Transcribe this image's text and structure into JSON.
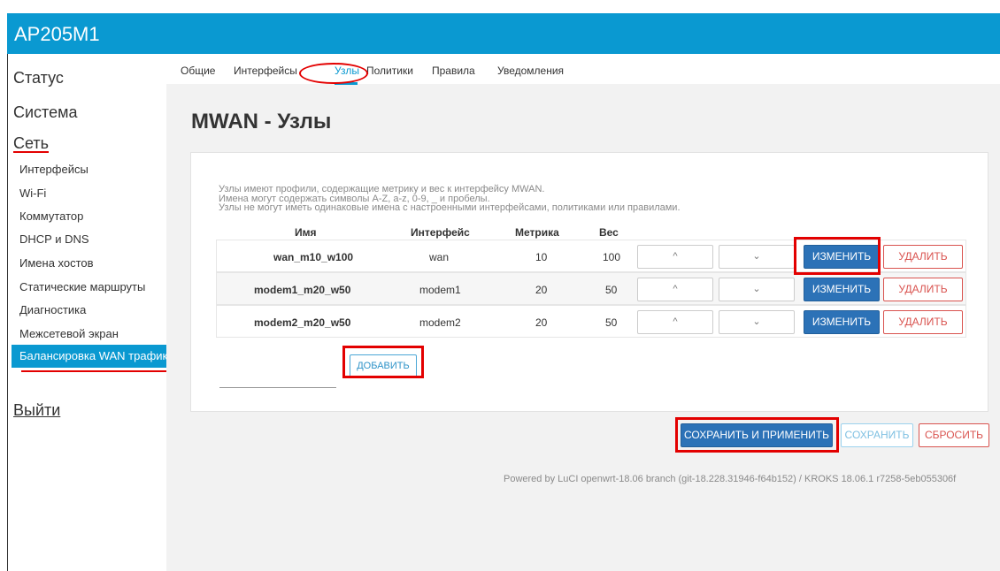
{
  "app": {
    "title": "AP205M1"
  },
  "sidebar": {
    "sections": [
      {
        "label": "Статус"
      },
      {
        "label": "Система"
      },
      {
        "label": "Сеть"
      }
    ],
    "items": [
      {
        "label": "Интерфейсы"
      },
      {
        "label": "Wi-Fi"
      },
      {
        "label": "Коммутатор"
      },
      {
        "label": "DHCP и DNS"
      },
      {
        "label": "Имена хостов"
      },
      {
        "label": "Статические маршруты"
      },
      {
        "label": "Диагностика"
      },
      {
        "label": "Межсетевой экран"
      },
      {
        "label": "Балансировка WAN трафика"
      }
    ],
    "logout": "Выйти"
  },
  "tabs": [
    {
      "label": "Общие"
    },
    {
      "label": "Интерфейсы"
    },
    {
      "label": "Узлы"
    },
    {
      "label": "Политики"
    },
    {
      "label": "Правила"
    },
    {
      "label": "Уведомления"
    }
  ],
  "page": {
    "title": "MWAN - Узлы",
    "description": [
      "Узлы имеют профили, содержащие метрику и вес к интерфейсу MWAN.",
      "Имена могут содержать символы A-Z, a-z, 0-9, _ и пробелы.",
      "Узлы не могут иметь одинаковые имена с настроенными интерфейсами, политиками или правилами."
    ]
  },
  "table": {
    "headers": {
      "name": "Имя",
      "interface": "Интерфейс",
      "metric": "Метрика",
      "weight": "Вес"
    },
    "rows": [
      {
        "name": "wan_m10_w100",
        "interface": "wan",
        "metric": "10",
        "weight": "100"
      },
      {
        "name": "modem1_m20_w50",
        "interface": "modem1",
        "metric": "20",
        "weight": "50"
      },
      {
        "name": "modem2_m20_w50",
        "interface": "modem2",
        "metric": "20",
        "weight": "50"
      }
    ],
    "up_glyph": "^",
    "down_glyph": "⌄",
    "edit_label": "ИЗМЕНИТЬ",
    "delete_label": "УДАЛИТЬ"
  },
  "add": {
    "button_label": "ДОБАВИТЬ",
    "value": ""
  },
  "actions": {
    "save_apply": "СОХРАНИТЬ И ПРИМЕНИТЬ",
    "save": "СОХРАНИТЬ",
    "reset": "СБРОСИТЬ"
  },
  "footer": {
    "text": "Powered by LuCI openwrt-18.06 branch (git-18.228.31946-f64b152) / KROKS 18.06.1 r7258-5eb055306f"
  },
  "colors": {
    "accent": "#0a99d1",
    "primary_button": "#2c72b7",
    "danger": "#d9534f",
    "highlight": "#e30000"
  }
}
